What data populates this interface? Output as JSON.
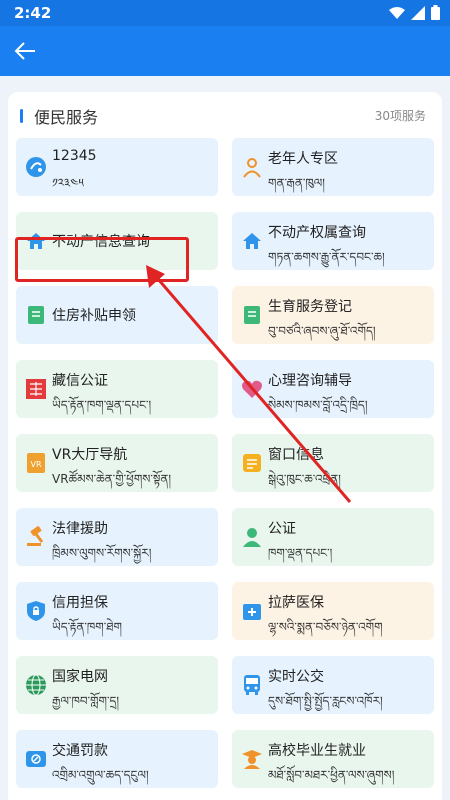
{
  "status": {
    "time": "2:42"
  },
  "section": {
    "title": "便民服务",
    "count": "30项服务"
  },
  "tiles": [
    {
      "title": "12345",
      "sub": "༡༢༣༤༥"
    },
    {
      "title": "老年人专区",
      "sub": "གན་རྒན་ཁུལ།"
    },
    {
      "title": "不动产信息查询",
      "sub": ""
    },
    {
      "title": "不动产权属查询",
      "sub": "གཏན་ཆགས་རྒྱུ་ནོར་དབང་ཆ།"
    },
    {
      "title": "住房补贴申领",
      "sub": ""
    },
    {
      "title": "生育服务登记",
      "sub": "བུ་བཙའི་ཞབས་ཞུ་ཐོ་འགོད།"
    },
    {
      "title": "藏信公证",
      "sub": "ཡིད་རྟོན་ཁག་ལྡན་དཔང་།"
    },
    {
      "title": "心理咨询辅导",
      "sub": "སེམས་ཁམས་བློ་འདྲི་ཁྲིད།"
    },
    {
      "title": "VR大厅导航",
      "sub": "VRཚོམས་ཆེན་གྱི་ཕྱོགས་སྟོན།"
    },
    {
      "title": "窗口信息",
      "sub": "སྒེའུ་ཁུང་ཆ་འཕྲིན།"
    },
    {
      "title": "法律援助",
      "sub": "ཁྲིམས་ལུགས་རོགས་སྐྱོར།"
    },
    {
      "title": "公证",
      "sub": "ཁག་ལྡན་དཔང་།"
    },
    {
      "title": "信用担保",
      "sub": "ཡིད་རྟོན་ཁག་ཐེག"
    },
    {
      "title": "拉萨医保",
      "sub": "ལྷ་སའི་སྨན་བཅོས་ཉེན་འགོག"
    },
    {
      "title": "国家电网",
      "sub": "རྒྱལ་ཁབ་གློག་དྲ།"
    },
    {
      "title": "实时公交",
      "sub": "དུས་ཐོག་སྤྱི་སྤྱོད་རླངས་འཁོར།"
    },
    {
      "title": "交通罚款",
      "sub": "འགྲིམ་འགྲུལ་ཆད་དངུལ།"
    },
    {
      "title": "高校毕业生就业",
      "sub": "མཐོ་སློབ་མཐར་ཕྱིན་ལས་ཞུགས།"
    }
  ],
  "colors": {
    "accent": "#1a7ff0",
    "highlight": "#e02424"
  }
}
